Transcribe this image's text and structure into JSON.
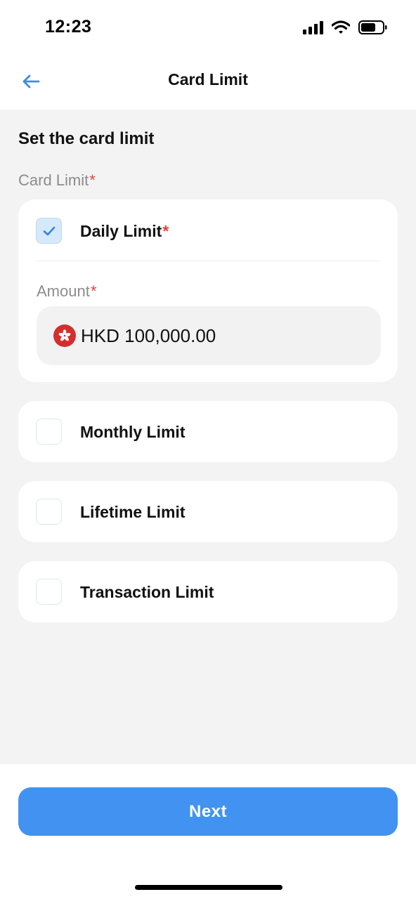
{
  "status_bar": {
    "time": "12:23"
  },
  "header": {
    "title": "Card Limit"
  },
  "form": {
    "heading": "Set the card limit",
    "card_limit_label": "Card Limit",
    "required_mark": "*"
  },
  "options": [
    {
      "label": "Daily Limit",
      "checked": true,
      "required_mark": "*"
    },
    {
      "label": "Monthly Limit",
      "checked": false
    },
    {
      "label": "Lifetime Limit",
      "checked": false
    },
    {
      "label": "Transaction Limit",
      "checked": false
    }
  ],
  "amount": {
    "label": "Amount",
    "required_mark": "*",
    "value": "HKD 100,000.00",
    "currency_icon": "hk-flag-icon"
  },
  "footer": {
    "next_label": "Next"
  },
  "colors": {
    "accent": "#4293f1",
    "required": "#e0443a",
    "checked_bg": "#d6e9fb",
    "background": "#f3f3f3"
  }
}
